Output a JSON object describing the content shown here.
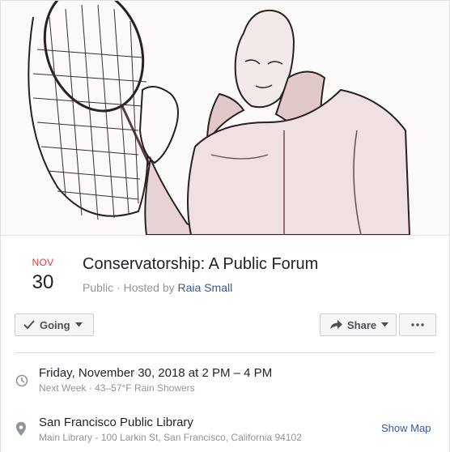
{
  "event": {
    "date_month": "NOV",
    "date_day": "30",
    "title": "Conservatorship: A Public Forum",
    "privacy": "Public",
    "hosted_by_prefix": " · Hosted by ",
    "host_name": "Raia Small"
  },
  "actions": {
    "going_label": "Going",
    "share_label": "Share"
  },
  "details": {
    "when_main": "Friday, November 30, 2018 at 2 PM – 4 PM",
    "when_sub": "Next Week · 43–57°F Rain Showers",
    "where_main": "San Francisco Public Library",
    "where_sub": "Main Library - 100 Larkin St, San Francisco, California 94102",
    "show_map_label": "Show Map"
  },
  "icons": {
    "going": "checkmark-icon",
    "share": "share-arrow-icon",
    "more": "more-dots-icon",
    "time": "clock-icon",
    "location": "map-pin-icon"
  },
  "colors": {
    "month_red": "#e0393e",
    "link_blue": "#365899",
    "secondary_gray": "#90949c",
    "button_bg": "#f5f6f7"
  }
}
